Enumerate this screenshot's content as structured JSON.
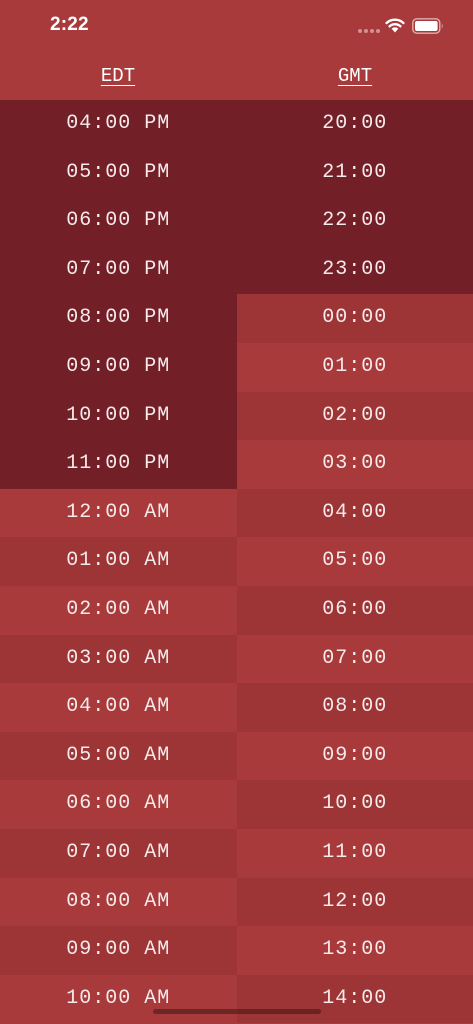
{
  "status_bar": {
    "time": "2:22"
  },
  "columns": {
    "left_label": "EDT",
    "right_label": "GMT"
  },
  "colors": {
    "night": "#731f28",
    "light": "#a83a3b",
    "alt": "#9d3536"
  },
  "rows": [
    {
      "local": "04:00 PM",
      "gmt": "20:00",
      "local_shade": "night",
      "gmt_shade": "night"
    },
    {
      "local": "05:00 PM",
      "gmt": "21:00",
      "local_shade": "night",
      "gmt_shade": "night"
    },
    {
      "local": "06:00 PM",
      "gmt": "22:00",
      "local_shade": "night",
      "gmt_shade": "night"
    },
    {
      "local": "07:00 PM",
      "gmt": "23:00",
      "local_shade": "night",
      "gmt_shade": "night"
    },
    {
      "local": "08:00 PM",
      "gmt": "00:00",
      "local_shade": "night",
      "gmt_shade": "alt"
    },
    {
      "local": "09:00 PM",
      "gmt": "01:00",
      "local_shade": "night",
      "gmt_shade": "light"
    },
    {
      "local": "10:00 PM",
      "gmt": "02:00",
      "local_shade": "night",
      "gmt_shade": "alt"
    },
    {
      "local": "11:00 PM",
      "gmt": "03:00",
      "local_shade": "night",
      "gmt_shade": "light"
    },
    {
      "local": "12:00 AM",
      "gmt": "04:00",
      "local_shade": "light",
      "gmt_shade": "alt"
    },
    {
      "local": "01:00 AM",
      "gmt": "05:00",
      "local_shade": "alt",
      "gmt_shade": "light"
    },
    {
      "local": "02:00 AM",
      "gmt": "06:00",
      "local_shade": "light",
      "gmt_shade": "alt"
    },
    {
      "local": "03:00 AM",
      "gmt": "07:00",
      "local_shade": "alt",
      "gmt_shade": "light"
    },
    {
      "local": "04:00 AM",
      "gmt": "08:00",
      "local_shade": "light",
      "gmt_shade": "alt"
    },
    {
      "local": "05:00 AM",
      "gmt": "09:00",
      "local_shade": "alt",
      "gmt_shade": "light"
    },
    {
      "local": "06:00 AM",
      "gmt": "10:00",
      "local_shade": "light",
      "gmt_shade": "alt"
    },
    {
      "local": "07:00 AM",
      "gmt": "11:00",
      "local_shade": "alt",
      "gmt_shade": "light"
    },
    {
      "local": "08:00 AM",
      "gmt": "12:00",
      "local_shade": "light",
      "gmt_shade": "alt"
    },
    {
      "local": "09:00 AM",
      "gmt": "13:00",
      "local_shade": "alt",
      "gmt_shade": "light"
    },
    {
      "local": "10:00 AM",
      "gmt": "14:00",
      "local_shade": "light",
      "gmt_shade": "alt"
    }
  ],
  "icons": {
    "signal": "cellular-signal-icon",
    "wifi": "wifi-icon",
    "battery": "battery-icon"
  }
}
